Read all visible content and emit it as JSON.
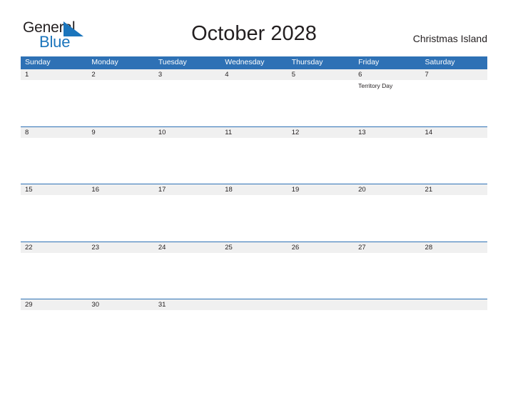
{
  "brand": {
    "name_part1": "General",
    "name_part2": "Blue",
    "triangle_icon": "triangle-icon",
    "colors": {
      "text_dark": "#231f20",
      "brand_blue": "#1b75bc",
      "header_blue": "#2e71b5",
      "strip_gray": "#f0f0f0"
    }
  },
  "header": {
    "month_title": "October 2028",
    "locale": "Christmas Island"
  },
  "calendar": {
    "weekdays": [
      "Sunday",
      "Monday",
      "Tuesday",
      "Wednesday",
      "Thursday",
      "Friday",
      "Saturday"
    ],
    "weeks": [
      {
        "days": [
          {
            "date": "1",
            "event": ""
          },
          {
            "date": "2",
            "event": ""
          },
          {
            "date": "3",
            "event": ""
          },
          {
            "date": "4",
            "event": ""
          },
          {
            "date": "5",
            "event": ""
          },
          {
            "date": "6",
            "event": "Territory Day"
          },
          {
            "date": "7",
            "event": ""
          }
        ]
      },
      {
        "days": [
          {
            "date": "8",
            "event": ""
          },
          {
            "date": "9",
            "event": ""
          },
          {
            "date": "10",
            "event": ""
          },
          {
            "date": "11",
            "event": ""
          },
          {
            "date": "12",
            "event": ""
          },
          {
            "date": "13",
            "event": ""
          },
          {
            "date": "14",
            "event": ""
          }
        ]
      },
      {
        "days": [
          {
            "date": "15",
            "event": ""
          },
          {
            "date": "16",
            "event": ""
          },
          {
            "date": "17",
            "event": ""
          },
          {
            "date": "18",
            "event": ""
          },
          {
            "date": "19",
            "event": ""
          },
          {
            "date": "20",
            "event": ""
          },
          {
            "date": "21",
            "event": ""
          }
        ]
      },
      {
        "days": [
          {
            "date": "22",
            "event": ""
          },
          {
            "date": "23",
            "event": ""
          },
          {
            "date": "24",
            "event": ""
          },
          {
            "date": "25",
            "event": ""
          },
          {
            "date": "26",
            "event": ""
          },
          {
            "date": "27",
            "event": ""
          },
          {
            "date": "28",
            "event": ""
          }
        ]
      },
      {
        "days": [
          {
            "date": "29",
            "event": ""
          },
          {
            "date": "30",
            "event": ""
          },
          {
            "date": "31",
            "event": ""
          },
          {
            "date": "",
            "event": ""
          },
          {
            "date": "",
            "event": ""
          },
          {
            "date": "",
            "event": ""
          },
          {
            "date": "",
            "event": ""
          }
        ]
      }
    ]
  }
}
